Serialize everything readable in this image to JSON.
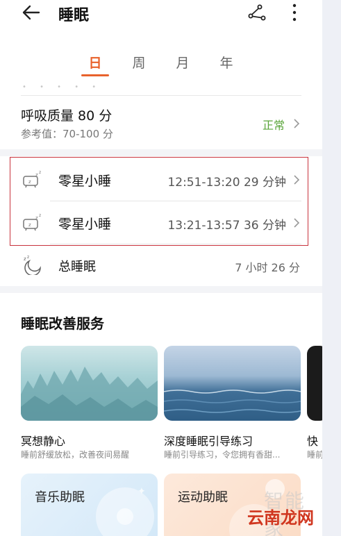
{
  "appbar": {
    "title": "睡眠",
    "back_icon": "back-arrow-icon",
    "share_icon": "share-icon",
    "more_icon": "more-vertical-icon"
  },
  "tabs": [
    {
      "label": "日",
      "active": true
    },
    {
      "label": "周",
      "active": false
    },
    {
      "label": "月",
      "active": false
    },
    {
      "label": "年",
      "active": false
    }
  ],
  "breathing": {
    "title": "呼吸质量  80 分",
    "reference": "参考值：70-100 分",
    "status": "正常",
    "status_color": "#5aa53a"
  },
  "naps": [
    {
      "label": "零星小睡",
      "time": "12:51-13:20   29 分钟"
    },
    {
      "label": "零星小睡",
      "time": "13:21-13:57   36 分钟"
    }
  ],
  "total": {
    "label": "总睡眠",
    "value": "7 小时 26 分"
  },
  "services": {
    "title": "睡眠改善服务",
    "cards": [
      {
        "name": "冥想静心",
        "desc": "睡前舒缓放松，改善夜间易醒"
      },
      {
        "name": "深度睡眠引导练习",
        "desc": "睡前引导练习，令您拥有香甜..."
      },
      {
        "name": "快",
        "desc": "睡前"
      }
    ],
    "mini_cards": [
      {
        "label": "音乐助眠"
      },
      {
        "label": "运动助眠"
      }
    ]
  },
  "watermark": {
    "faint": "智能家",
    "brand": "云南龙网"
  },
  "colors": {
    "accent": "#e8622c",
    "highlight": "#c8323c"
  }
}
